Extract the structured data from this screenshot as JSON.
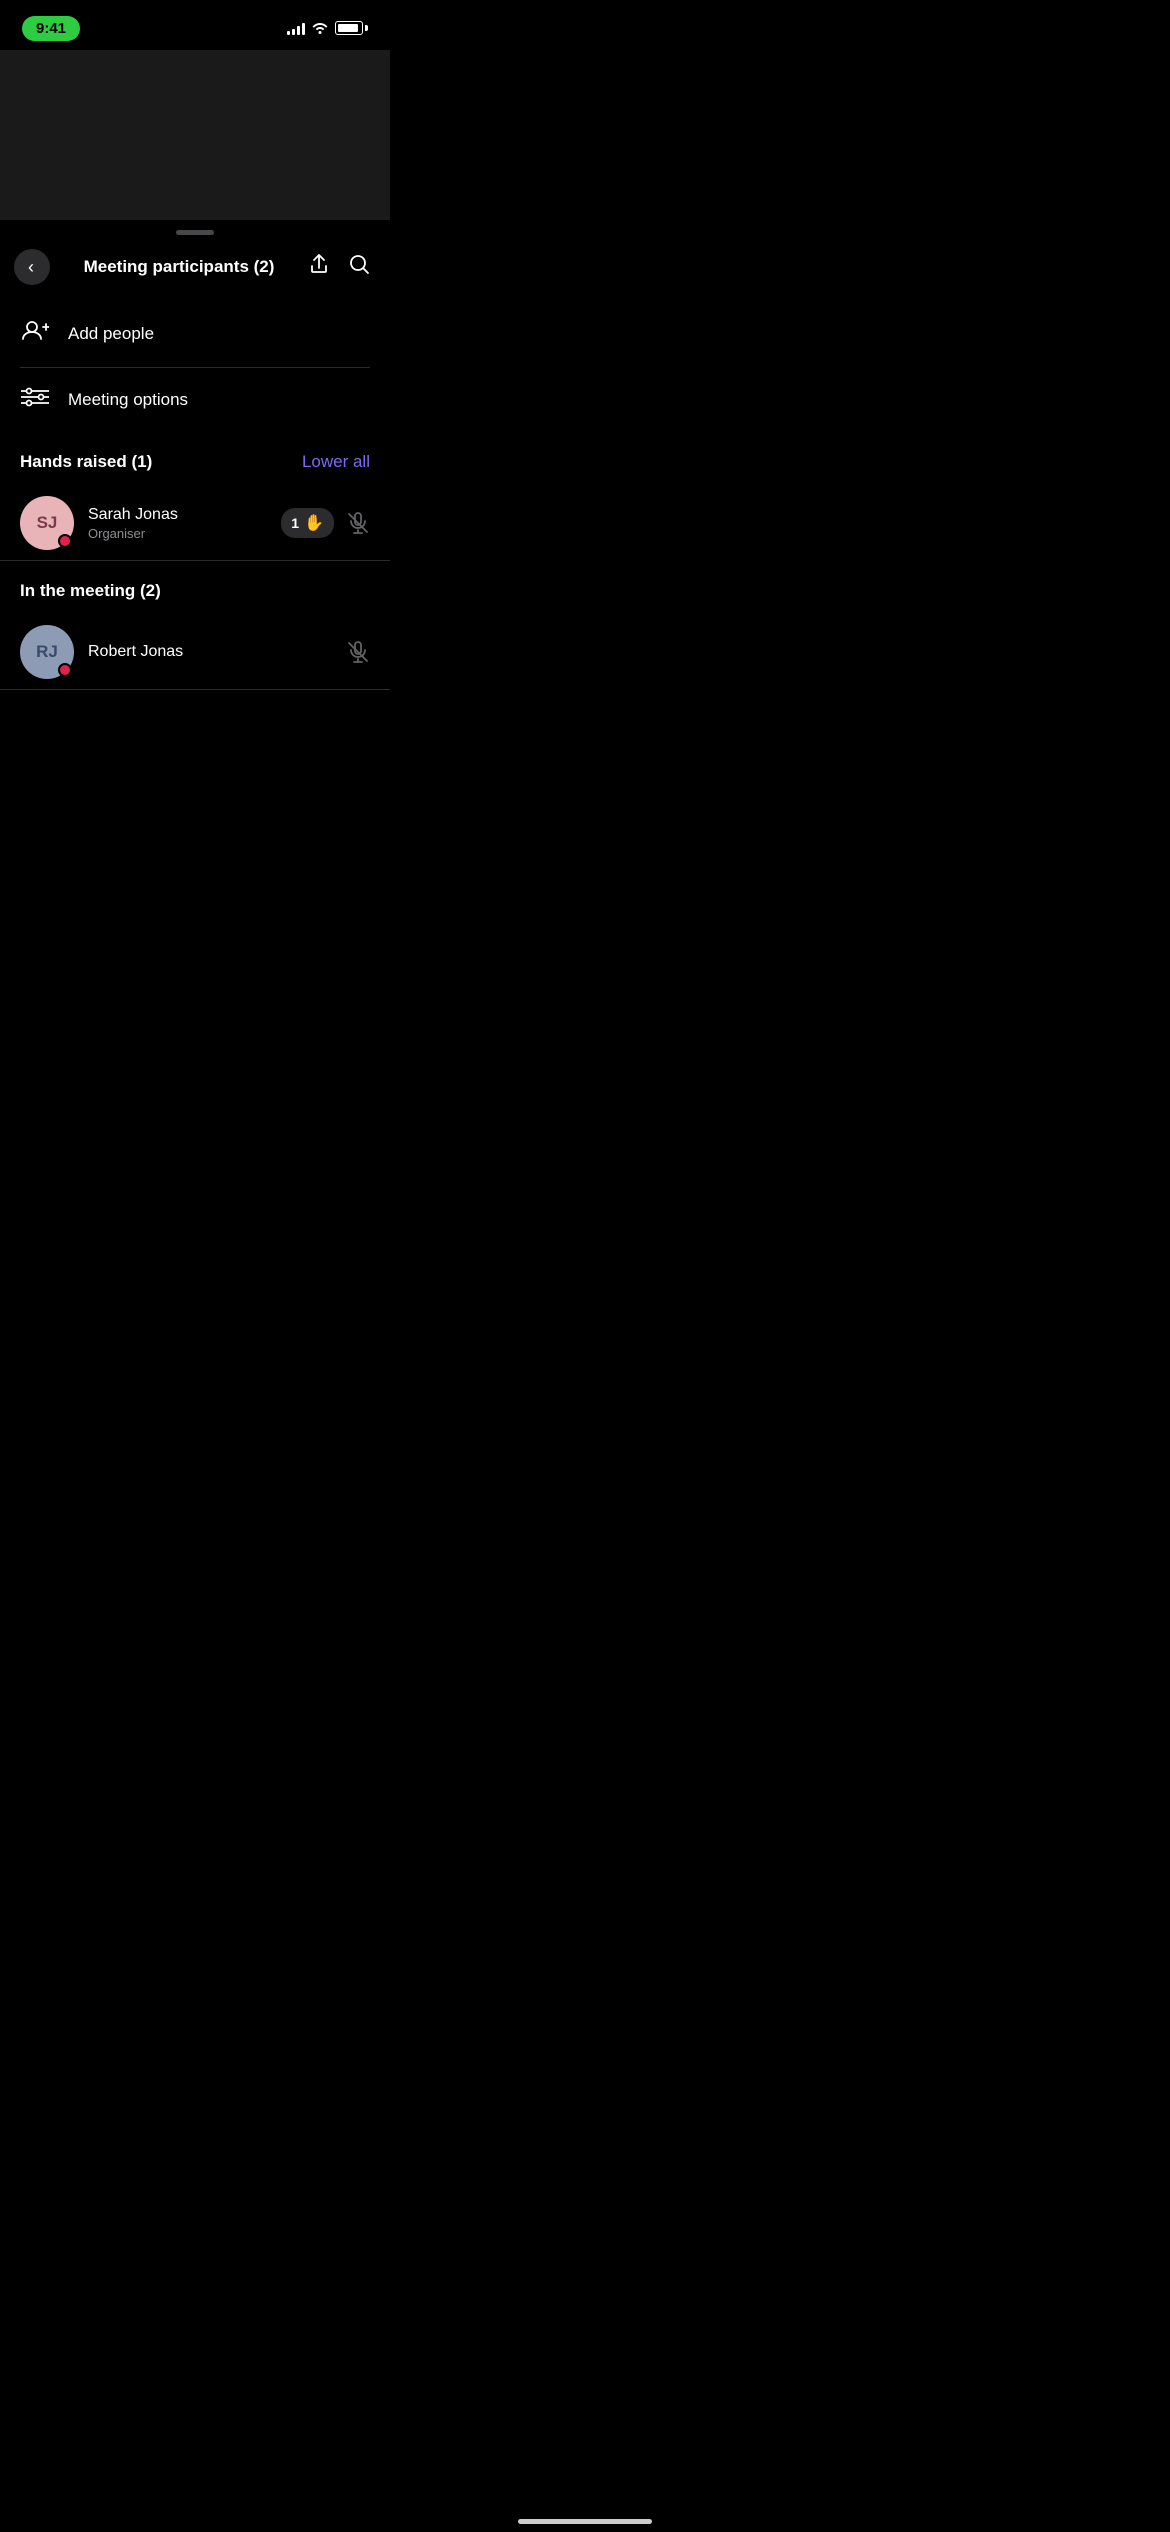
{
  "statusBar": {
    "time": "9:41",
    "batteryLevel": 90
  },
  "header": {
    "title": "Meeting participants (2)",
    "backLabel": "‹",
    "shareIconLabel": "share",
    "searchIconLabel": "search"
  },
  "menuItems": [
    {
      "id": "add-people",
      "icon": "add-people",
      "label": "Add people"
    },
    {
      "id": "meeting-options",
      "icon": "settings-sliders",
      "label": "Meeting options"
    }
  ],
  "handsRaisedSection": {
    "title": "Hands raised (1)",
    "lowerAllLabel": "Lower all",
    "participants": [
      {
        "name": "Sarah Jonas",
        "initials": "SJ",
        "role": "Organiser",
        "handCount": 1,
        "muted": true,
        "online": true,
        "avatarColor": "sj"
      }
    ]
  },
  "inMeetingSection": {
    "title": "In the meeting (2)",
    "participants": [
      {
        "name": "Robert Jonas",
        "initials": "RJ",
        "role": "",
        "muted": true,
        "online": true,
        "avatarColor": "rj"
      }
    ]
  }
}
